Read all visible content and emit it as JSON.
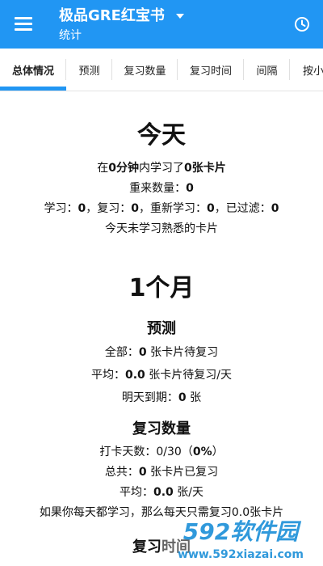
{
  "appbar": {
    "title": "极品GRE红宝书",
    "subtitle": "统计"
  },
  "tabs": [
    {
      "label": "总体情况",
      "active": true
    },
    {
      "label": "预测"
    },
    {
      "label": "复习数量"
    },
    {
      "label": "复习时间"
    },
    {
      "label": "间隔"
    },
    {
      "label": "按小"
    }
  ],
  "today": {
    "heading": "今天",
    "line1": {
      "p1": "在",
      "v1": "0分钟",
      "p2": "内学习了",
      "v2": "0张卡片"
    },
    "line2": {
      "label": "重来数量：",
      "value": "0"
    },
    "line3": {
      "l1": "学习：",
      "v1": "0",
      "l2": "，复习：",
      "v2": "0",
      "l3": "，重新学习：",
      "v3": "0",
      "l4": "，已过滤：",
      "v4": "0"
    },
    "line4": "今天未学习熟悉的卡片"
  },
  "month": {
    "heading": "1个月",
    "forecast": {
      "heading": "预测",
      "total": {
        "label": "全部：",
        "value": "0",
        "suffix": " 张卡片待复习"
      },
      "avg": {
        "label": "平均：",
        "value": "0.0",
        "suffix": " 张卡片待复习/天"
      },
      "tomorrow": {
        "label": "明天到期：",
        "value": "0",
        "suffix": " 张"
      }
    },
    "review_count": {
      "heading": "复习数量",
      "days": {
        "label": "打卡天数：0/30（",
        "value": "0%",
        "suffix": "）"
      },
      "total": {
        "label": "总共：",
        "value": "0",
        "suffix": " 张卡片已复习"
      },
      "avg": {
        "label": "平均：",
        "value": "0.0",
        "suffix": " 张/天"
      },
      "note": "如果你每天都学习，那么每天只需复习0.0张卡片"
    },
    "review_time_heading": "复习时间"
  },
  "watermark": {
    "brand": "592软件园",
    "url": "www.592xiazai.com"
  },
  "colors": {
    "primary": "#2196f3",
    "watermark_blue": "#1a8fd8",
    "watermark_red": "#e84a3d"
  }
}
